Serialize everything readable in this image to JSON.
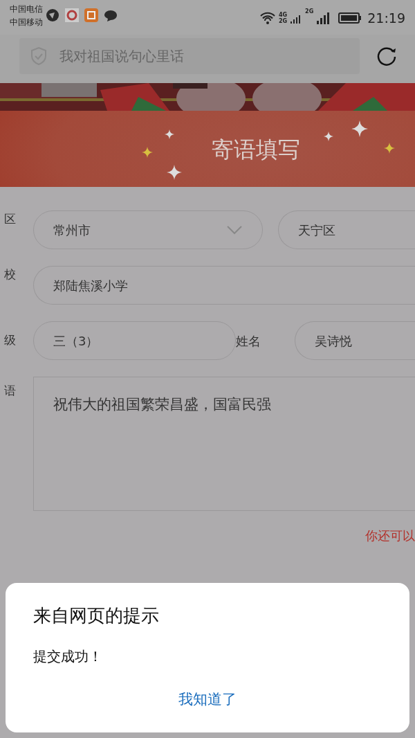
{
  "status_bar": {
    "carriers": [
      "中国电信",
      "中国移动"
    ],
    "network_labels": [
      "4G",
      "2G",
      "2G"
    ],
    "time": "21:19"
  },
  "header": {
    "search": {
      "placeholder": "我对祖国说句心里话"
    }
  },
  "banner": {
    "title": "寄语填写"
  },
  "form": {
    "region": {
      "label": "区",
      "city": "常州市",
      "district": "天宁区"
    },
    "school": {
      "label": "校",
      "value": "郑陆焦溪小学"
    },
    "class": {
      "label": "级",
      "value": "三（3）"
    },
    "name": {
      "label": "姓名",
      "value": "吴诗悦"
    },
    "message": {
      "label": "语",
      "value": "祝伟大的祖国繁荣昌盛，国富民强"
    },
    "hint": "你还可以"
  },
  "dialog": {
    "title": "来自网页的提示",
    "message": "提交成功！",
    "button": "我知道了"
  }
}
